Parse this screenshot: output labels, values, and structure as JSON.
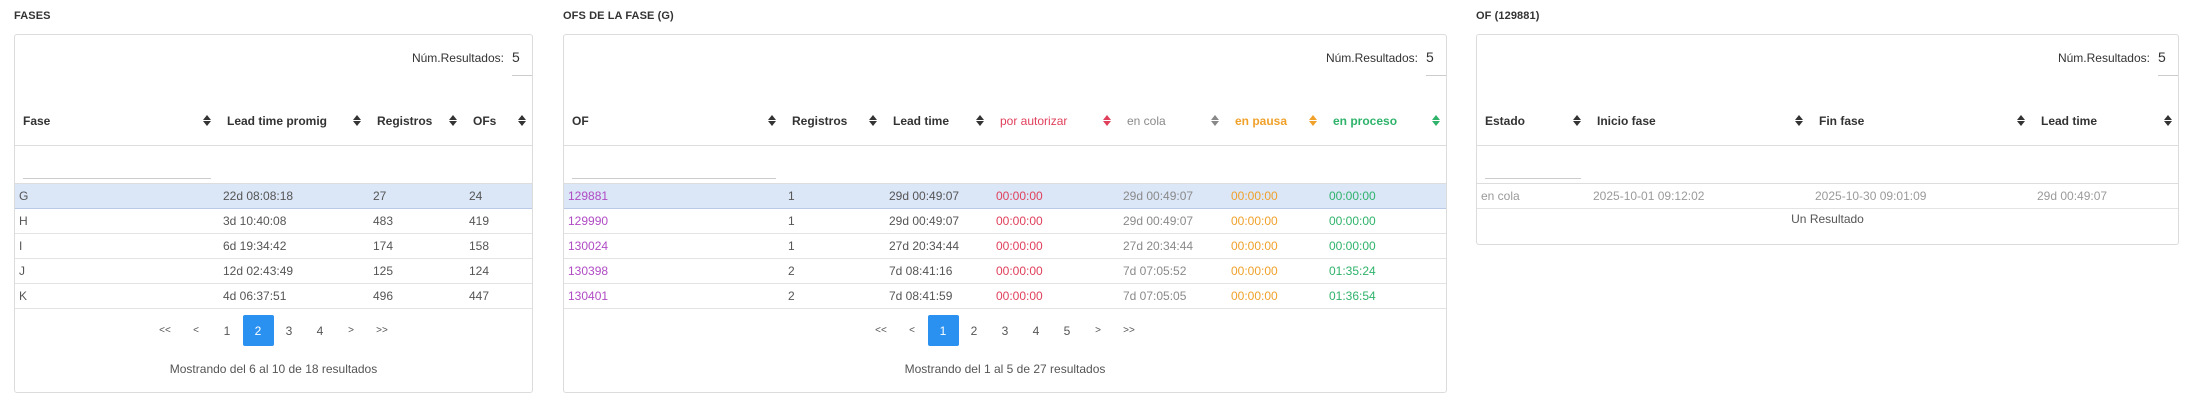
{
  "fases": {
    "title": "FASES",
    "num_label": "Núm.Resultados:",
    "num_value": "5",
    "columns": [
      "Fase",
      "Lead time promig",
      "Registros",
      "OFs"
    ],
    "rows": [
      [
        "G",
        "22d 08:08:18",
        "27",
        "24"
      ],
      [
        "H",
        "3d 10:40:08",
        "483",
        "419"
      ],
      [
        "I",
        "6d 19:34:42",
        "174",
        "158"
      ],
      [
        "J",
        "12d 02:43:49",
        "125",
        "124"
      ],
      [
        "K",
        "4d 06:37:51",
        "496",
        "447"
      ]
    ],
    "pager": [
      "<<",
      "<",
      "1",
      "2",
      "3",
      "4",
      ">",
      ">>"
    ],
    "active_page": "2",
    "showing": "Mostrando del 6 al 10 de 18 resultados"
  },
  "ofs": {
    "title": "OFS DE LA FASE (G)",
    "num_label": "Núm.Resultados:",
    "num_value": "5",
    "columns": [
      "OF",
      "Registros",
      "Lead time",
      "por autorizar",
      "en cola",
      "en pausa",
      "en proceso"
    ],
    "rows": [
      [
        "129881",
        "1",
        "29d 00:49:07",
        "00:00:00",
        "29d 00:49:07",
        "00:00:00",
        "00:00:00"
      ],
      [
        "129990",
        "1",
        "29d 00:49:07",
        "00:00:00",
        "29d 00:49:07",
        "00:00:00",
        "00:00:00"
      ],
      [
        "130024",
        "1",
        "27d 20:34:44",
        "00:00:00",
        "27d 20:34:44",
        "00:00:00",
        "00:00:00"
      ],
      [
        "130398",
        "2",
        "7d 08:41:16",
        "00:00:00",
        "7d 07:05:52",
        "00:00:00",
        "01:35:24"
      ],
      [
        "130401",
        "2",
        "7d 08:41:59",
        "00:00:00",
        "7d 07:05:05",
        "00:00:00",
        "01:36:54"
      ]
    ],
    "pager": [
      "<<",
      "<",
      "1",
      "2",
      "3",
      "4",
      "5",
      ">",
      ">>"
    ],
    "active_page": "1",
    "showing": "Mostrando del 1 al 5 de 27 resultados"
  },
  "of": {
    "title": "OF (129881)",
    "num_label": "Núm.Resultados:",
    "num_value": "5",
    "columns": [
      "Estado",
      "Inicio fase",
      "Fin fase",
      "Lead time"
    ],
    "rows": [
      [
        "en cola",
        "2025-10-01 09:12:02",
        "2025-10-30 09:01:09",
        "29d 00:49:07"
      ]
    ],
    "footer": "Un Resultado"
  },
  "colors": {
    "selected_row": "#dbe6f7",
    "active_page": "#2a91f0",
    "of_link": "#b04bc4",
    "por_autorizar": "#e0405b",
    "en_cola": "#8a8a8a",
    "en_pausa": "#f0a12a",
    "en_proceso": "#2fb36b"
  }
}
